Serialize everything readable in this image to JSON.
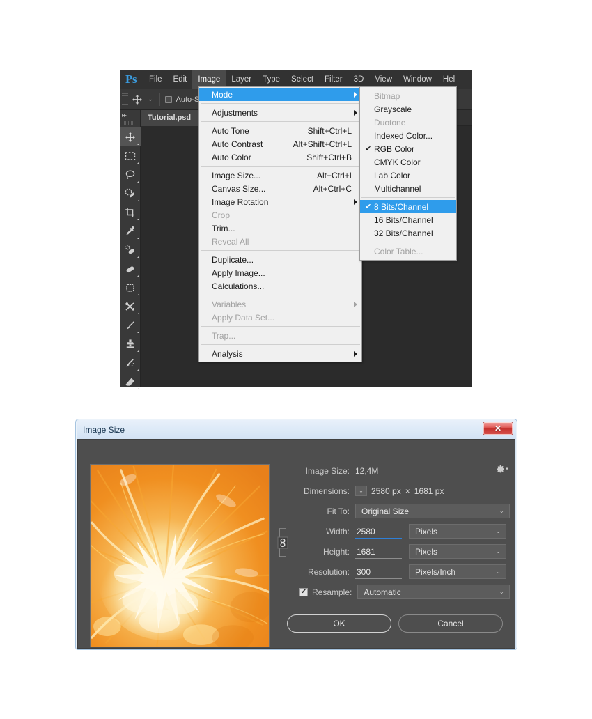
{
  "app": {
    "logo": "Ps",
    "menus": [
      {
        "label": "File",
        "mnemonic": "F"
      },
      {
        "label": "Edit",
        "mnemonic": "E"
      },
      {
        "label": "Image",
        "mnemonic": "I",
        "active": true
      },
      {
        "label": "Layer",
        "mnemonic": "L"
      },
      {
        "label": "Type",
        "mnemonic": "T"
      },
      {
        "label": "Select",
        "mnemonic": "S"
      },
      {
        "label": "Filter",
        "mnemonic": "t"
      },
      {
        "label": "3D",
        "mnemonic": "D"
      },
      {
        "label": "View",
        "mnemonic": "V"
      },
      {
        "label": "Window",
        "mnemonic": "W"
      },
      {
        "label": "Hel",
        "mnemonic": "H"
      }
    ],
    "option_bar": {
      "tool_icon": "move-tool-icon",
      "auto_select_label": "Auto-S",
      "auto_select_checked": false
    },
    "document_tab": "Tutorial.psd",
    "tools": [
      {
        "name": "move-tool",
        "selected": true
      },
      {
        "name": "rectangular-marquee-tool",
        "selected": false
      },
      {
        "name": "lasso-tool",
        "selected": false
      },
      {
        "name": "quick-selection-tool",
        "selected": false
      },
      {
        "name": "crop-tool",
        "selected": false
      },
      {
        "name": "eyedropper-tool",
        "selected": false
      },
      {
        "name": "spot-healing-brush-tool",
        "selected": false
      },
      {
        "name": "patch-tool",
        "selected": false
      },
      {
        "name": "content-aware-move-tool",
        "selected": false
      },
      {
        "name": "red-eye-tool",
        "selected": false
      },
      {
        "name": "brush-tool",
        "selected": false
      },
      {
        "name": "clone-stamp-tool",
        "selected": false
      },
      {
        "name": "history-brush-tool",
        "selected": false
      },
      {
        "name": "eraser-tool",
        "selected": false
      }
    ]
  },
  "image_menu": {
    "groups": [
      [
        {
          "label": "Mode",
          "accel": "",
          "submenu": true,
          "highlighted": true,
          "disabled": false
        }
      ],
      [
        {
          "label": "Adjustments",
          "accel": "",
          "submenu": true,
          "highlighted": false,
          "disabled": false
        }
      ],
      [
        {
          "label": "Auto Tone",
          "accel": "Shift+Ctrl+L",
          "submenu": false,
          "highlighted": false,
          "disabled": false
        },
        {
          "label": "Auto Contrast",
          "accel": "Alt+Shift+Ctrl+L",
          "submenu": false,
          "highlighted": false,
          "disabled": false
        },
        {
          "label": "Auto Color",
          "accel": "Shift+Ctrl+B",
          "submenu": false,
          "highlighted": false,
          "disabled": false
        }
      ],
      [
        {
          "label": "Image Size...",
          "accel": "Alt+Ctrl+I",
          "submenu": false,
          "highlighted": false,
          "disabled": false
        },
        {
          "label": "Canvas Size...",
          "accel": "Alt+Ctrl+C",
          "submenu": false,
          "highlighted": false,
          "disabled": false
        },
        {
          "label": "Image Rotation",
          "accel": "",
          "submenu": true,
          "highlighted": false,
          "disabled": false
        },
        {
          "label": "Crop",
          "accel": "",
          "submenu": false,
          "highlighted": false,
          "disabled": true
        },
        {
          "label": "Trim...",
          "accel": "",
          "submenu": false,
          "highlighted": false,
          "disabled": false
        },
        {
          "label": "Reveal All",
          "accel": "",
          "submenu": false,
          "highlighted": false,
          "disabled": true
        }
      ],
      [
        {
          "label": "Duplicate...",
          "accel": "",
          "submenu": false,
          "highlighted": false,
          "disabled": false
        },
        {
          "label": "Apply Image...",
          "accel": "",
          "submenu": false,
          "highlighted": false,
          "disabled": false
        },
        {
          "label": "Calculations...",
          "accel": "",
          "submenu": false,
          "highlighted": false,
          "disabled": false
        }
      ],
      [
        {
          "label": "Variables",
          "accel": "",
          "submenu": true,
          "highlighted": false,
          "disabled": true
        },
        {
          "label": "Apply Data Set...",
          "accel": "",
          "submenu": false,
          "highlighted": false,
          "disabled": true
        }
      ],
      [
        {
          "label": "Trap...",
          "accel": "",
          "submenu": false,
          "highlighted": false,
          "disabled": true
        }
      ],
      [
        {
          "label": "Analysis",
          "accel": "",
          "submenu": true,
          "highlighted": false,
          "disabled": false
        }
      ]
    ]
  },
  "mode_submenu": {
    "groups": [
      [
        {
          "label": "Bitmap",
          "checked": false,
          "highlighted": false,
          "disabled": true
        },
        {
          "label": "Grayscale",
          "checked": false,
          "highlighted": false,
          "disabled": false
        },
        {
          "label": "Duotone",
          "checked": false,
          "highlighted": false,
          "disabled": true
        },
        {
          "label": "Indexed Color...",
          "checked": false,
          "highlighted": false,
          "disabled": false
        },
        {
          "label": "RGB Color",
          "checked": true,
          "highlighted": false,
          "disabled": false
        },
        {
          "label": "CMYK Color",
          "checked": false,
          "highlighted": false,
          "disabled": false
        },
        {
          "label": "Lab Color",
          "checked": false,
          "highlighted": false,
          "disabled": false
        },
        {
          "label": "Multichannel",
          "checked": false,
          "highlighted": false,
          "disabled": false
        }
      ],
      [
        {
          "label": "8 Bits/Channel",
          "checked": true,
          "highlighted": true,
          "disabled": false
        },
        {
          "label": "16 Bits/Channel",
          "checked": false,
          "highlighted": false,
          "disabled": false
        },
        {
          "label": "32 Bits/Channel",
          "checked": false,
          "highlighted": false,
          "disabled": false
        }
      ],
      [
        {
          "label": "Color Table...",
          "checked": false,
          "highlighted": false,
          "disabled": true
        }
      ]
    ]
  },
  "dialog": {
    "title": "Image Size",
    "close_label": "✕",
    "image_size_label": "Image Size:",
    "image_size_value": "12,4M",
    "dimensions_label": "Dimensions:",
    "dimensions_width": "2580 px",
    "dimensions_separator": "×",
    "dimensions_height": "1681 px",
    "fit_to_label": "Fit To:",
    "fit_to_value": "Original Size",
    "width_label": "Width:",
    "width_value": "2580",
    "width_unit": "Pixels",
    "height_label": "Height:",
    "height_value": "1681",
    "height_unit": "Pixels",
    "resolution_label": "Resolution:",
    "resolution_value": "300",
    "resolution_unit": "Pixels/Inch",
    "resample_label": "Resample:",
    "resample_checked": true,
    "resample_value": "Automatic",
    "ok_label": "OK",
    "cancel_label": "Cancel",
    "preview_alt": "orange-fruit-closeup-preview"
  },
  "colors": {
    "accent_blue": "#2f9ceb",
    "panel_dark": "#393939",
    "dialog_body": "#4e4e4e",
    "canvas_dark": "#2b2b2b",
    "menu_light": "#f0f0f0",
    "focus_underline": "#2f7fd6"
  }
}
